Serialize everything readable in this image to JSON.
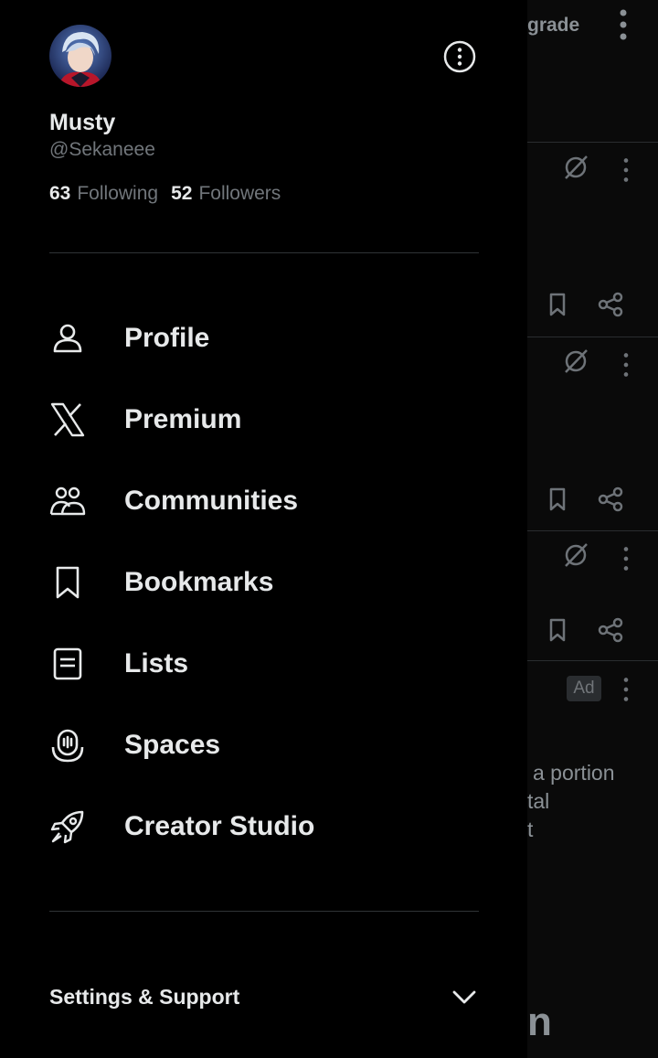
{
  "profile": {
    "display_name": "Musty",
    "handle": "@Sekaneee",
    "following_count": "63",
    "following_label": "Following",
    "followers_count": "52",
    "followers_label": "Followers"
  },
  "menu": [
    {
      "label": "Profile",
      "icon": "person-icon"
    },
    {
      "label": "Premium",
      "icon": "x-logo-icon"
    },
    {
      "label": "Communities",
      "icon": "communities-icon"
    },
    {
      "label": "Bookmarks",
      "icon": "bookmark-icon"
    },
    {
      "label": "Lists",
      "icon": "list-icon"
    },
    {
      "label": "Spaces",
      "icon": "spaces-icon"
    },
    {
      "label": "Creator Studio",
      "icon": "rocket-icon"
    }
  ],
  "settings": {
    "label": "Settings & Support"
  },
  "feed": {
    "header_partial": "grade",
    "ad_label": "Ad",
    "snippet_lines": [
      "a portion",
      "tal",
      "t"
    ],
    "bottom_partial": "n"
  },
  "colors": {
    "background": "#000000",
    "text": "#e7e9ea",
    "muted": "#71767b",
    "divider": "#2f3336"
  }
}
